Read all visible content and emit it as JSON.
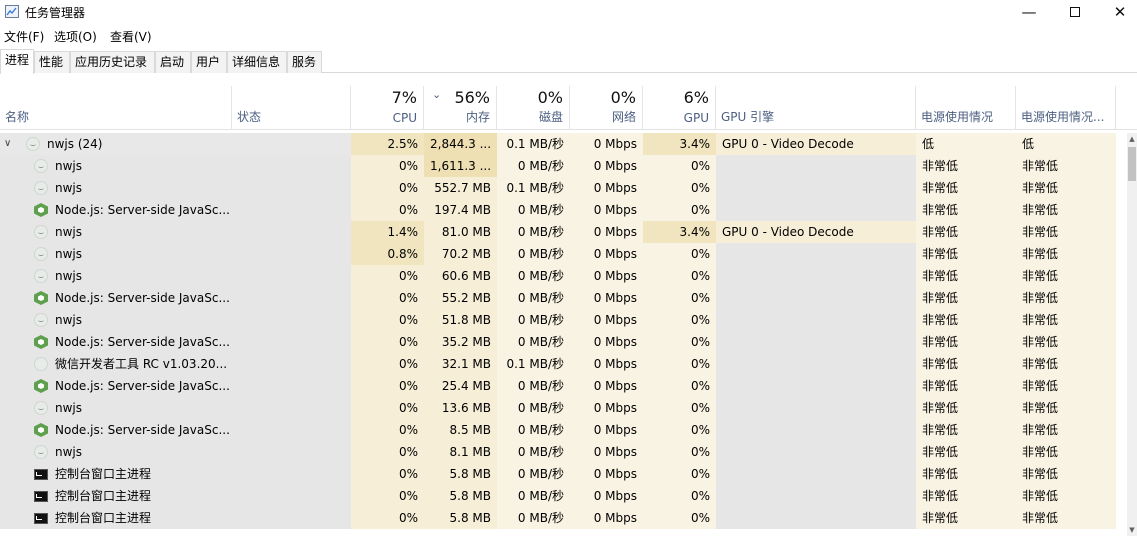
{
  "window": {
    "title": "任务管理器"
  },
  "menu": [
    "文件(F)",
    "选项(O)",
    "查看(V)"
  ],
  "tabs": [
    "进程",
    "性能",
    "应用历史记录",
    "启动",
    "用户",
    "详细信息",
    "服务"
  ],
  "active_tab": "进程",
  "header": {
    "name": "名称",
    "status": "状态",
    "cpu": {
      "pct": "7%",
      "label": "CPU"
    },
    "mem": {
      "pct": "56%",
      "label": "内存"
    },
    "disk": {
      "pct": "0%",
      "label": "磁盘"
    },
    "net": {
      "pct": "0%",
      "label": "网络"
    },
    "gpu": {
      "pct": "6%",
      "label": "GPU"
    },
    "gpu_engine": "GPU 引擎",
    "power": "电源使用情况",
    "power_trend": "电源使用情况..."
  },
  "rows": [
    {
      "name": "nwjs (24)",
      "icon": "nwjs",
      "group": true,
      "cpu": "2.5%",
      "mem": "2,844.3 ...",
      "disk": "0.1 MB/秒",
      "net": "0 Mbps",
      "gpu": "3.4%",
      "engine": "GPU 0 - Video Decode",
      "power": "低",
      "trend": "低"
    },
    {
      "name": "nwjs",
      "icon": "nwjs",
      "cpu": "0%",
      "mem": "1,611.3 ...",
      "disk": "0 MB/秒",
      "net": "0 Mbps",
      "gpu": "0%",
      "engine": "",
      "power": "非常低",
      "trend": "非常低"
    },
    {
      "name": "nwjs",
      "icon": "nwjs",
      "cpu": "0%",
      "mem": "552.7 MB",
      "disk": "0.1 MB/秒",
      "net": "0 Mbps",
      "gpu": "0%",
      "engine": "",
      "power": "非常低",
      "trend": "非常低"
    },
    {
      "name": "Node.js: Server-side JavaSc...",
      "icon": "node",
      "cpu": "0%",
      "mem": "197.4 MB",
      "disk": "0 MB/秒",
      "net": "0 Mbps",
      "gpu": "0%",
      "engine": "",
      "power": "非常低",
      "trend": "非常低"
    },
    {
      "name": "nwjs",
      "icon": "nwjs",
      "cpu": "1.4%",
      "mem": "81.0 MB",
      "disk": "0 MB/秒",
      "net": "0 Mbps",
      "gpu": "3.4%",
      "engine": "GPU 0 - Video Decode",
      "power": "非常低",
      "trend": "非常低"
    },
    {
      "name": "nwjs",
      "icon": "nwjs",
      "cpu": "0.8%",
      "mem": "70.2 MB",
      "disk": "0 MB/秒",
      "net": "0 Mbps",
      "gpu": "0%",
      "engine": "",
      "power": "非常低",
      "trend": "非常低"
    },
    {
      "name": "nwjs",
      "icon": "nwjs",
      "cpu": "0%",
      "mem": "60.6 MB",
      "disk": "0 MB/秒",
      "net": "0 Mbps",
      "gpu": "0%",
      "engine": "",
      "power": "非常低",
      "trend": "非常低"
    },
    {
      "name": "Node.js: Server-side JavaSc...",
      "icon": "node",
      "cpu": "0%",
      "mem": "55.2 MB",
      "disk": "0 MB/秒",
      "net": "0 Mbps",
      "gpu": "0%",
      "engine": "",
      "power": "非常低",
      "trend": "非常低"
    },
    {
      "name": "nwjs",
      "icon": "nwjs",
      "cpu": "0%",
      "mem": "51.8 MB",
      "disk": "0 MB/秒",
      "net": "0 Mbps",
      "gpu": "0%",
      "engine": "",
      "power": "非常低",
      "trend": "非常低"
    },
    {
      "name": "Node.js: Server-side JavaSc...",
      "icon": "node",
      "cpu": "0%",
      "mem": "35.2 MB",
      "disk": "0 MB/秒",
      "net": "0 Mbps",
      "gpu": "0%",
      "engine": "",
      "power": "非常低",
      "trend": "非常低"
    },
    {
      "name": "微信开发者工具 RC v1.03.20...",
      "icon": "wx",
      "cpu": "0%",
      "mem": "32.1 MB",
      "disk": "0.1 MB/秒",
      "net": "0 Mbps",
      "gpu": "0%",
      "engine": "",
      "power": "非常低",
      "trend": "非常低"
    },
    {
      "name": "Node.js: Server-side JavaSc...",
      "icon": "node",
      "cpu": "0%",
      "mem": "25.4 MB",
      "disk": "0 MB/秒",
      "net": "0 Mbps",
      "gpu": "0%",
      "engine": "",
      "power": "非常低",
      "trend": "非常低"
    },
    {
      "name": "nwjs",
      "icon": "nwjs",
      "cpu": "0%",
      "mem": "13.6 MB",
      "disk": "0 MB/秒",
      "net": "0 Mbps",
      "gpu": "0%",
      "engine": "",
      "power": "非常低",
      "trend": "非常低"
    },
    {
      "name": "Node.js: Server-side JavaSc...",
      "icon": "node",
      "cpu": "0%",
      "mem": "8.5 MB",
      "disk": "0 MB/秒",
      "net": "0 Mbps",
      "gpu": "0%",
      "engine": "",
      "power": "非常低",
      "trend": "非常低"
    },
    {
      "name": "nwjs",
      "icon": "nwjs",
      "cpu": "0%",
      "mem": "8.1 MB",
      "disk": "0 MB/秒",
      "net": "0 Mbps",
      "gpu": "0%",
      "engine": "",
      "power": "非常低",
      "trend": "非常低"
    },
    {
      "name": "控制台窗口主进程",
      "icon": "console",
      "cpu": "0%",
      "mem": "5.8 MB",
      "disk": "0 MB/秒",
      "net": "0 Mbps",
      "gpu": "0%",
      "engine": "",
      "power": "非常低",
      "trend": "非常低"
    },
    {
      "name": "控制台窗口主进程",
      "icon": "console",
      "cpu": "0%",
      "mem": "5.8 MB",
      "disk": "0 MB/秒",
      "net": "0 Mbps",
      "gpu": "0%",
      "engine": "",
      "power": "非常低",
      "trend": "非常低"
    },
    {
      "name": "控制台窗口主进程",
      "icon": "console",
      "cpu": "0%",
      "mem": "5.8 MB",
      "disk": "0 MB/秒",
      "net": "0 Mbps",
      "gpu": "0%",
      "engine": "",
      "power": "非常低",
      "trend": "非常低"
    }
  ]
}
